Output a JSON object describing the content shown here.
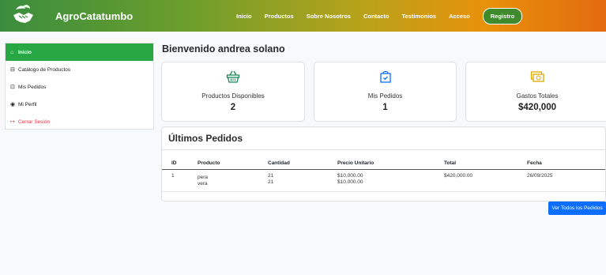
{
  "brand": {
    "name": "AgroCatatumbo",
    "logo_icon": "handshake-leaf-logo"
  },
  "nav": {
    "links": [
      "Inicio",
      "Productos",
      "Sobre Nosotros",
      "Contacto",
      "Testimonios",
      "Acceso"
    ],
    "register_label": "Registro"
  },
  "sidebar": {
    "items": [
      {
        "icon": "home-icon",
        "glyph": "⌂",
        "label": "Inicio"
      },
      {
        "icon": "basket-icon",
        "glyph": "⊟",
        "label": "Catálogo de Productos"
      },
      {
        "icon": "bag-icon",
        "glyph": "⊡",
        "label": "Mis Pedidos"
      },
      {
        "icon": "user-icon",
        "glyph": "◉",
        "label": "Mi Perfil"
      },
      {
        "icon": "logout-icon",
        "glyph": "↦",
        "label": "Cerrar Sesión"
      }
    ]
  },
  "welcome": "Bienvenido andrea solano",
  "cards": [
    {
      "icon": "basket-icon",
      "label": "Productos Disponibles",
      "value": "2"
    },
    {
      "icon": "bag-check-icon",
      "label": "Mis Pedidos",
      "value": "1"
    },
    {
      "icon": "cash-icon",
      "label": "Gastos Totales",
      "value": "$420,000"
    }
  ],
  "orders": {
    "title": "Últimos Pedidos",
    "columns": [
      "ID",
      "Producto",
      "Cantidad",
      "Precio Unitario",
      "Total",
      "Fecha"
    ],
    "rows": [
      {
        "id": "1",
        "products": [
          "pera",
          "vera"
        ],
        "quantities": [
          "21",
          "21"
        ],
        "unit_prices": [
          "$10,000.00",
          "$10,000.00"
        ],
        "total": "$420,000.00",
        "date": "26/09/2025"
      }
    ],
    "view_all_label": "Ver Todos los Pedidos"
  },
  "colors": {
    "accent_green": "#28a745",
    "primary_blue": "#0d6efd",
    "logout_red": "#dc3545"
  }
}
